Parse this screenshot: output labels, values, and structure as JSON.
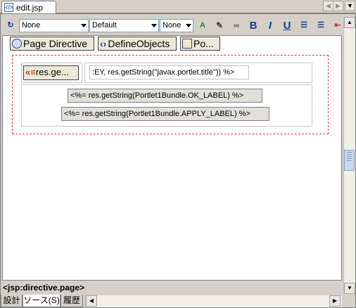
{
  "tab": {
    "title": "edit.jsp",
    "nav_prev": "◀",
    "nav_next": "▶",
    "menu": "▼"
  },
  "toolbar": {
    "style_combo": "None",
    "font_combo": "Default",
    "size_combo": "None",
    "bold": "B",
    "italic": "I",
    "underline": "U"
  },
  "editor": {
    "palette": {
      "page_directive": "Page Directive",
      "define_objects": "DefineObjects",
      "portlet": "Po..."
    },
    "row1": {
      "button": "res.ge...",
      "expression": ":EY, res.getString(\"javax.portlet.title\")) %>"
    },
    "row2": {
      "ok_expression": "<%= res.getString(Portlet1Bundle.OK_LABEL) %>",
      "apply_expression": "<%= res.getString(Portlet1Bundle.APPLY_LABEL) %>"
    }
  },
  "status": {
    "breadcrumb": "<jsp:directive.page>"
  },
  "bottom_tabs": [
    {
      "label": "設計"
    },
    {
      "label": "ソース(S)"
    },
    {
      "label": "履歴"
    }
  ],
  "colors": {
    "dashed_border": "#e53b3b",
    "accent": "#1a3d8f"
  }
}
